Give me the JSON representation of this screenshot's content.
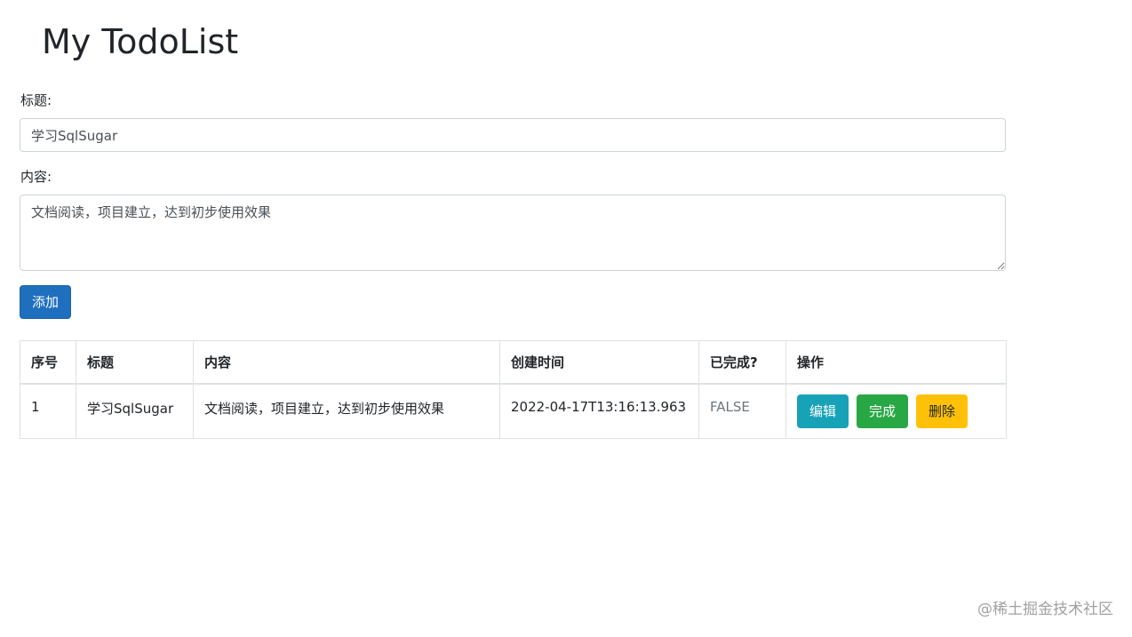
{
  "app": {
    "title": "My TodoList"
  },
  "form": {
    "title_label": "标题:",
    "title_value": "学习SqlSugar",
    "content_label": "内容:",
    "content_value": "文档阅读，项目建立，达到初步使用效果",
    "add_button_label": "添加"
  },
  "table": {
    "headers": {
      "index": "序号",
      "title": "标题",
      "content": "内容",
      "created": "创建时间",
      "done": "已完成?",
      "actions": "操作"
    },
    "rows": [
      {
        "index": "1",
        "title": "学习SqlSugar",
        "content": "文档阅读，项目建立，达到初步使用效果",
        "created": "2022-04-17T13:16:13.963",
        "done": "FALSE",
        "edit_label": "编辑",
        "complete_label": "完成",
        "delete_label": "删除"
      }
    ]
  },
  "watermark": "@稀土掘金技术社区",
  "colors": {
    "primary": "#1f6fbf",
    "info": "#17a2b8",
    "success": "#28a745",
    "warning": "#ffc107",
    "muted": "#6c757d",
    "border": "#dee2e6"
  }
}
